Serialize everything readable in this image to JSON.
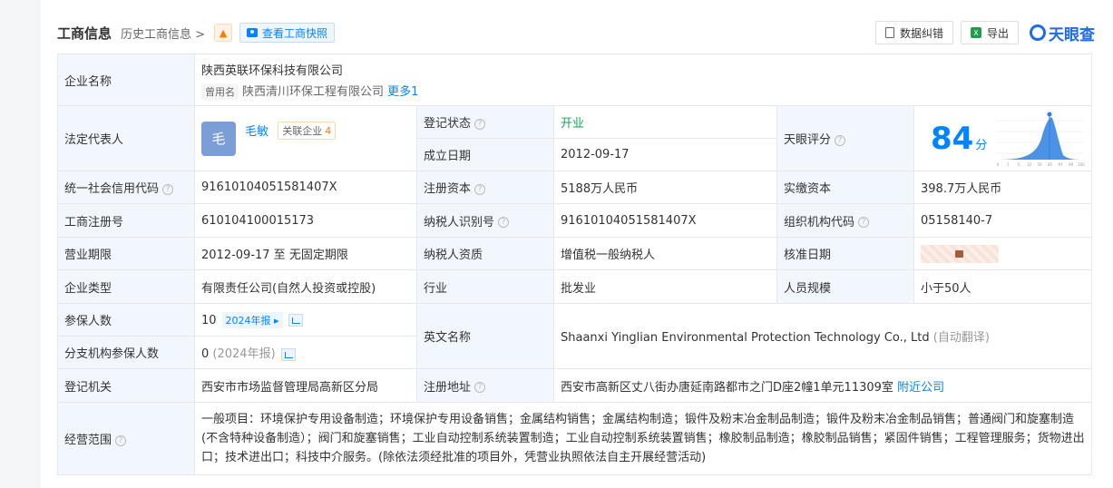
{
  "header": {
    "title": "工商信息",
    "history": "历史工商信息 >",
    "snapshot": "查看工商快照",
    "correct": "数据纠错",
    "export": "导出",
    "brand": "天眼查"
  },
  "company": {
    "name_label": "企业名称",
    "name": "陕西英联环保科技有限公司",
    "former_tag": "曾用名",
    "former_name": "陕西清川环保工程有限公司",
    "more": "更多1"
  },
  "legal_rep": {
    "label": "法定代表人",
    "avatar_char": "毛",
    "name": "毛敏",
    "related_label": "关联企业",
    "related_count": "4"
  },
  "reg_status": {
    "label": "登记状态",
    "value": "开业"
  },
  "found_date": {
    "label": "成立日期",
    "value": "2012-09-17"
  },
  "rating": {
    "label": "天眼评分",
    "score": "84",
    "unit": "分",
    "axis": [
      "0",
      "1",
      "5",
      "10",
      "50",
      "85",
      "97",
      "99",
      "100"
    ]
  },
  "credit_code": {
    "label": "统一社会信用代码",
    "value": "91610104051581407X"
  },
  "reg_capital": {
    "label": "注册资本",
    "value": "5188万人民币"
  },
  "paid_capital": {
    "label": "实缴资本",
    "value": "398.7万人民币"
  },
  "reg_no": {
    "label": "工商注册号",
    "value": "610104100015173"
  },
  "taxpayer_id": {
    "label": "纳税人识别号",
    "value": "91610104051581407X"
  },
  "org_code": {
    "label": "组织机构代码",
    "value": "05158140-7"
  },
  "term": {
    "label": "营业期限",
    "value": "2012-09-17 至 无固定期限"
  },
  "tax_quality": {
    "label": "纳税人资质",
    "value": "增值税一般纳税人"
  },
  "approve_date": {
    "label": "核准日期"
  },
  "company_type": {
    "label": "企业类型",
    "value": "有限责任公司(自然人投资或控股)"
  },
  "industry": {
    "label": "行业",
    "value": "批发业"
  },
  "staff_size": {
    "label": "人员规模",
    "value": "小于50人"
  },
  "insured": {
    "label": "参保人数",
    "value": "10",
    "year_btn": "2024年报"
  },
  "branch_insured": {
    "label": "分支机构参保人数",
    "value": "0",
    "year": "(2024年报)"
  },
  "english_name": {
    "label": "英文名称",
    "value": "Shaanxi Yinglian Environmental Protection Technology Co., Ltd",
    "note": "(自动翻译)"
  },
  "authority": {
    "label": "登记机关",
    "value": "西安市市场监督管理局高新区分局"
  },
  "address": {
    "label": "注册地址",
    "value": "西安市高新区丈八街办唐延南路都市之门D座2幢1单元11309室",
    "nearby": "附近公司"
  },
  "scope": {
    "label": "经营范围",
    "value": "一般项目：环境保护专用设备制造；环境保护专用设备销售；金属结构销售；金属结构制造；锻件及粉末冶金制品制造；锻件及粉末冶金制品销售；普通阀门和旋塞制造(不含特种设备制造）；阀门和旋塞销售；工业自动控制系统装置制造；工业自动控制系统装置销售；橡胶制品制造；橡胶制品销售；紧固件销售；工程管理服务；货物进出口；技术进出口；科技中介服务。(除依法须经批准的项目外，凭营业执照依法自主开展经营活动)"
  }
}
